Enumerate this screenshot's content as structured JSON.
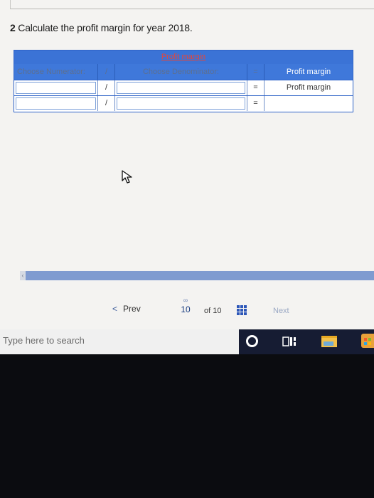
{
  "question": {
    "number": "2",
    "text": "Calculate the profit margin for year 2018."
  },
  "table": {
    "title": "Profit margin",
    "headers": {
      "numerator": "Choose Numerator:",
      "divide": "/",
      "denominator": "Choose Denominator:",
      "equals": "=",
      "result": "Profit margin"
    },
    "rows": [
      {
        "divide": "/",
        "equals": "=",
        "result": "Profit margin"
      },
      {
        "divide": "/",
        "equals": "=",
        "result": ""
      }
    ]
  },
  "nav": {
    "prev": "Prev",
    "current_page": "10",
    "of_total": "of 10",
    "next": "Next"
  },
  "taskbar": {
    "search_placeholder": "Type here to search"
  },
  "colors": {
    "table_header": "#3b73d6",
    "table_border": "#2f64c8",
    "taskbar": "#161c33"
  },
  "icons": [
    "cursor-arrow-icon",
    "chevron-left-icon",
    "link-icon",
    "grid-icon",
    "cortana-icon",
    "task-view-icon",
    "file-explorer-icon",
    "store-icon"
  ]
}
